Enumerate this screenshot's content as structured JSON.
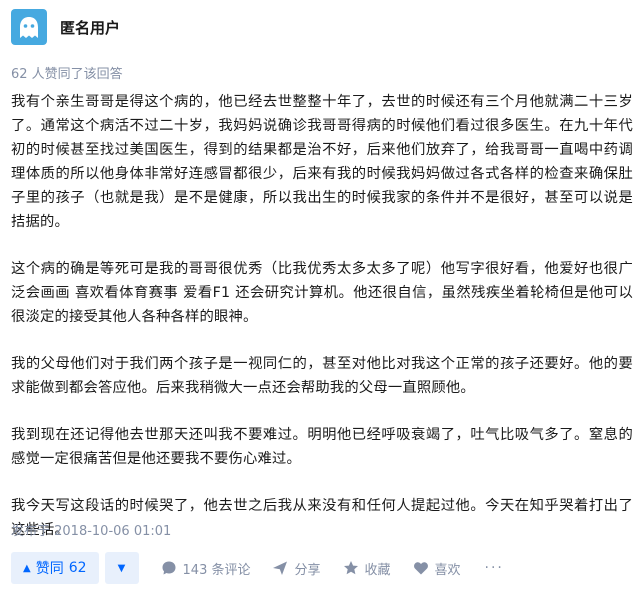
{
  "author": {
    "name": "匿名用户",
    "avatar": "anonymous-ghost-avatar"
  },
  "vote_summary": "62 人赞同了该回答",
  "paragraphs": [
    "我有个亲生哥哥是得这个病的，他已经去世整整十年了，去世的时候还有三个月他就满二十三岁了。通常这个病活不过二十岁，我妈妈说确诊我哥哥得病的时候他们看过很多医生。在九十年代初的时候甚至找过美国医生，得到的结果都是治不好，后来他们放弃了，给我哥哥一直喝中药调理体质的所以他身体非常好连感冒都很少，后来有我的时候我妈妈做过各式各样的检查来确保肚子里的孩子（也就是我）是不是健康，所以我出生的时候我家的条件并不是很好，甚至可以说是拮据的。",
    "这个病的确是等死可是我的哥哥很优秀（比我优秀太多太多了呢）他写字很好看，他爱好也很广泛会画画 喜欢看体育赛事 爱看F1 还会研究计算机。他还很自信，虽然残疾坐着轮椅但是他可以很淡定的接受其他人各种各样的眼神。",
    "我的父母他们对于我们两个孩子是一视同仁的，甚至对他比对我这个正常的孩子还要好。他的要求能做到都会答应他。后来我稍微大一点还会帮助我的父母一直照顾他。",
    "我到现在还记得他去世那天还叫我不要难过。明明他已经呼吸衰竭了，吐气比吸气多了。窒息的感觉一定很痛苦但是他还要我不要伤心难过。",
    "我今天写这段话的时候哭了，他去世之后我从来没有和任何人提起过他。今天在知乎哭着打出了这些话。"
  ],
  "publish_time": "发布于 2018-10-06 01:01",
  "actions": {
    "upvote_label": "赞同",
    "upvote_count": "62",
    "comments": "143 条评论",
    "share": "分享",
    "collect": "收藏",
    "like": "喜欢",
    "more": "···"
  },
  "colors": {
    "accent": "#0066ff",
    "accent_bg": "#e8f0fc",
    "muted": "#8590a6",
    "avatar_bg": "#46a9e0"
  }
}
